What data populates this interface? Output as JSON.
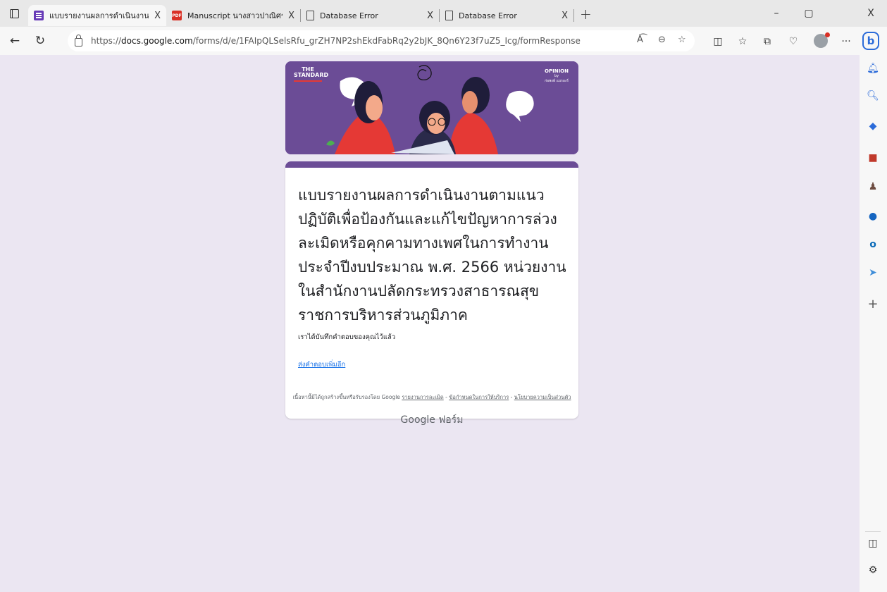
{
  "tabs": [
    {
      "title": "แบบรายงานผลการดำเนินงานตามแนว",
      "close": "X",
      "icon": "forms-icon",
      "active": true
    },
    {
      "title": "Manuscript นางสาวปาณิศรา ยามีพ",
      "close": "X",
      "icon": "pdf-icon",
      "active": false
    },
    {
      "title": "Database Error",
      "close": "X",
      "icon": "document-icon",
      "active": false
    },
    {
      "title": "Database Error",
      "close": "X",
      "icon": "document-icon",
      "active": false
    }
  ],
  "new_tab": "+",
  "window_controls": {
    "minimize": "–",
    "restore": "▢",
    "close": "X"
  },
  "address_bar": {
    "url_prefix": "https://",
    "url_domain": "docs.google.com",
    "url_path": "/forms/d/e/1FAIpQLSelsRfu_grZH7NP2shEkdFabRq2y2bJK_8Qn6Y23f7uZ5_Icg/formResponse"
  },
  "banner": {
    "brand_line1": "THE",
    "brand_line2": "STANDARD",
    "opinion": "OPINION",
    "opinion_by": "by",
    "opinion_author": "ก่อพงษ์ แบรองร์"
  },
  "form": {
    "title": "แบบรายงานผลการดำเนินงานตามแนวปฏิบัติเพื่อป้องกันและแก้ไขปัญหาการล่วงละเมิดหรือคุกคามทางเพศในการทำงาน ประจำปีงบประมาณ พ.ศ. 2566 หน่วยงานในสำนักงานปลัดกระทรวงสาธารณสุข ราชการบริหารส่วนภูมิภาค",
    "confirmation": "เราได้บันทึกคำตอบของคุณไว้แล้ว",
    "submit_another": "ส่งคำตอบเพิ่มอีก"
  },
  "footer": {
    "note": "เนื้อหานี้มิได้ถูกสร้างขึ้นหรือรับรองโดย Google",
    "report_abuse": "รายงานการละเมิด",
    "terms": "ข้อกำหนดในการให้บริการ",
    "privacy": "นโยบายความเป็นส่วนตัว",
    "sep": " - ",
    "brand": "Google ฟอร์ม"
  },
  "colors": {
    "theme_purple": "#6b4c96",
    "page_bg": "#ebe6f2",
    "link_blue": "#1a73e8"
  }
}
